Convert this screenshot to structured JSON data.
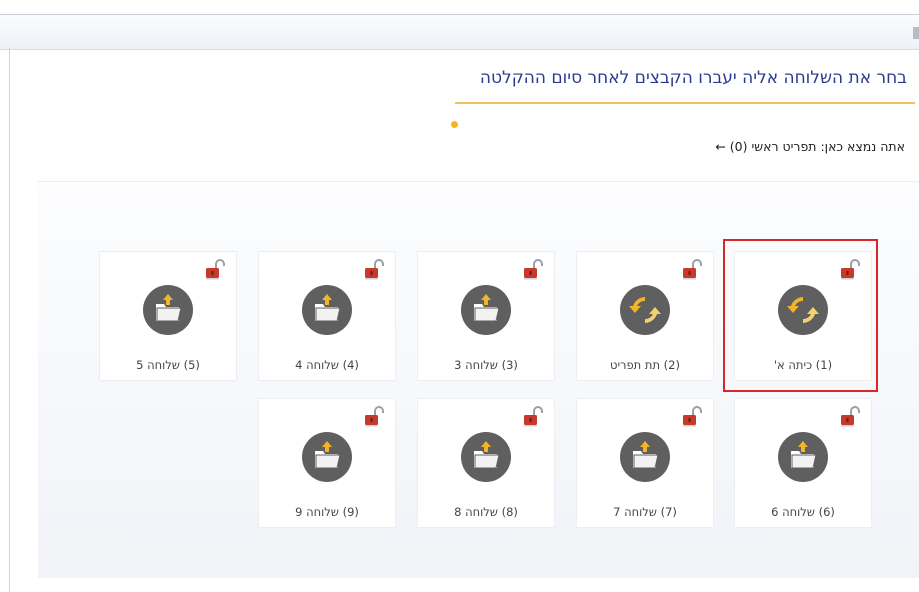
{
  "header": {
    "title": "בחר את השלוחה אליה יעברו הקבצים לאחר סיום ההקלטה",
    "location": "אתה נמצא כאן: תפריט ראשי (0) ←"
  },
  "tiles": [
    {
      "label": "(1) כיתה א'",
      "icon": "refresh-icon",
      "selected": true
    },
    {
      "label": "(2) תת תפריט",
      "icon": "refresh-icon",
      "selected": false
    },
    {
      "label": "(3) שלוחה 3",
      "icon": "folder-upload-icon",
      "selected": false
    },
    {
      "label": "(4) שלוחה 4",
      "icon": "folder-upload-icon",
      "selected": false
    },
    {
      "label": "(5) שלוחה 5",
      "icon": "folder-upload-icon",
      "selected": false
    },
    {
      "label": "(6) שלוחה 6",
      "icon": "folder-upload-icon",
      "selected": false
    },
    {
      "label": "(7) שלוחה 7",
      "icon": "folder-upload-icon",
      "selected": false
    },
    {
      "label": "(8) שלוחה 8",
      "icon": "folder-upload-icon",
      "selected": false
    },
    {
      "label": "(9) שלוחה 9",
      "icon": "folder-upload-icon",
      "selected": false
    }
  ],
  "colors": {
    "title": "#2a3b8f",
    "accent": "#f2b824",
    "selection": "#d9262a",
    "icon_circle": "#5f5f5f",
    "lock_red": "#c63a2c"
  }
}
